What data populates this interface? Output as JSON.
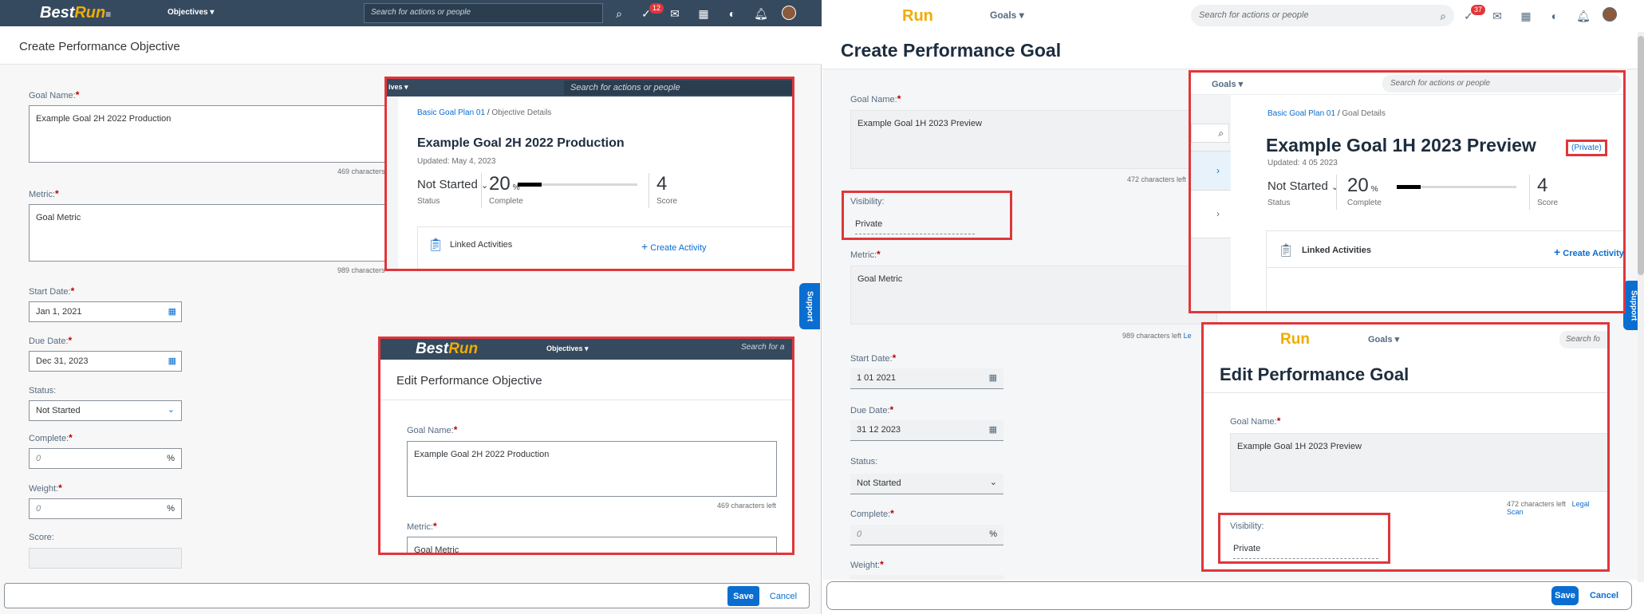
{
  "left": {
    "shell": {
      "brand_a": "Best",
      "brand_b": "Run",
      "menu": "Objectives",
      "search_placeholder": "Search for actions or people",
      "badge": "12"
    },
    "title": "Create Performance Objective",
    "goal_name_label": "Goal Name:",
    "goal_name_value": "Example Goal 2H 2022 Production",
    "goal_name_hint": "469 characters",
    "metric_label": "Metric:",
    "metric_value": "Goal Metric",
    "metric_hint": "989 characters",
    "start_label": "Start Date:",
    "start_value": "Jan 1, 2021",
    "due_label": "Due Date:",
    "due_value": "Dec 31, 2023",
    "status_label": "Status:",
    "status_value": "Not Started",
    "complete_label": "Complete:",
    "complete_placeholder": "0",
    "weight_label": "Weight:",
    "weight_placeholder": "0",
    "score_label": "Score:",
    "percent": "%",
    "save": "Save",
    "cancel": "Cancel",
    "support": "Support",
    "inset1": {
      "menu_fragment": "ives",
      "search_placeholder": "Search for actions or people",
      "breadcrumb_link": "Basic Goal Plan 01",
      "breadcrumb_sep": "/",
      "breadcrumb_current": "Objective Details",
      "goal_title": "Example Goal 2H 2022 Production",
      "updated": "Updated: May 4, 2023",
      "status_value": "Not Started",
      "status_label": "Status",
      "complete_value": "20",
      "complete_unit": "%",
      "complete_label": "Complete",
      "score_value": "4",
      "score_label": "Score",
      "linked": "Linked Activities",
      "create_activity": "Create Activity",
      "progress": 0.2
    },
    "inset2": {
      "brand_a": "Best",
      "brand_b": "Run",
      "menu": "Objectives",
      "search_fragment": "Search for a",
      "title": "Edit Performance Objective",
      "goal_name_label": "Goal Name:",
      "goal_name_value": "Example Goal 2H 2022 Production",
      "goal_name_hint": "469 characters left",
      "metric_label": "Metric:",
      "metric_value": "Goal Metric"
    }
  },
  "right": {
    "shell": {
      "brand": "Run",
      "menu": "Goals",
      "search_placeholder": "Search for actions or people",
      "badge": "37"
    },
    "title": "Create Performance Goal",
    "goal_name_label": "Goal Name:",
    "goal_name_value": "Example Goal 1H 2023 Preview",
    "goal_name_hint": "472 characters left",
    "visibility_label": "Visibility:",
    "visibility_value": "Private",
    "metric_label": "Metric:",
    "metric_value": "Goal Metric",
    "metric_hint": "989 characters left",
    "metric_link": "Le",
    "start_label": "Start Date:",
    "start_value": "1 01 2021",
    "due_label": "Due Date:",
    "due_value": "31 12 2023",
    "status_label": "Status:",
    "status_value": "Not Started",
    "complete_label": "Complete:",
    "complete_placeholder": "0",
    "weight_label": "Weight:",
    "percent": "%",
    "save": "Save",
    "cancel": "Cancel",
    "support": "Support",
    "inset1": {
      "menu": "Goals",
      "search_placeholder": "Search for actions or people",
      "breadcrumb_link": "Basic Goal Plan 01",
      "breadcrumb_sep": "/",
      "breadcrumb_current": "Goal Details",
      "goal_title": "Example Goal 1H 2023 Preview",
      "private_tag": "(Private)",
      "updated": "Updated: 4 05 2023",
      "status_value": "Not Started",
      "status_label": "Status",
      "complete_value": "20",
      "complete_unit": "%",
      "complete_label": "Complete",
      "score_value": "4",
      "score_label": "Score",
      "linked": "Linked Activities",
      "create_activity": "Create Activity",
      "progress": 0.2
    },
    "inset2": {
      "brand": "Run",
      "menu": "Goals",
      "search_fragment": "Search fo",
      "title": "Edit Performance Goal",
      "goal_name_label": "Goal Name:",
      "goal_name_value": "Example Goal 1H 2023 Preview",
      "goal_name_hint": "472 characters left",
      "legal_scan": "Legal Scan",
      "visibility_label": "Visibility:",
      "visibility_value": "Private"
    }
  }
}
